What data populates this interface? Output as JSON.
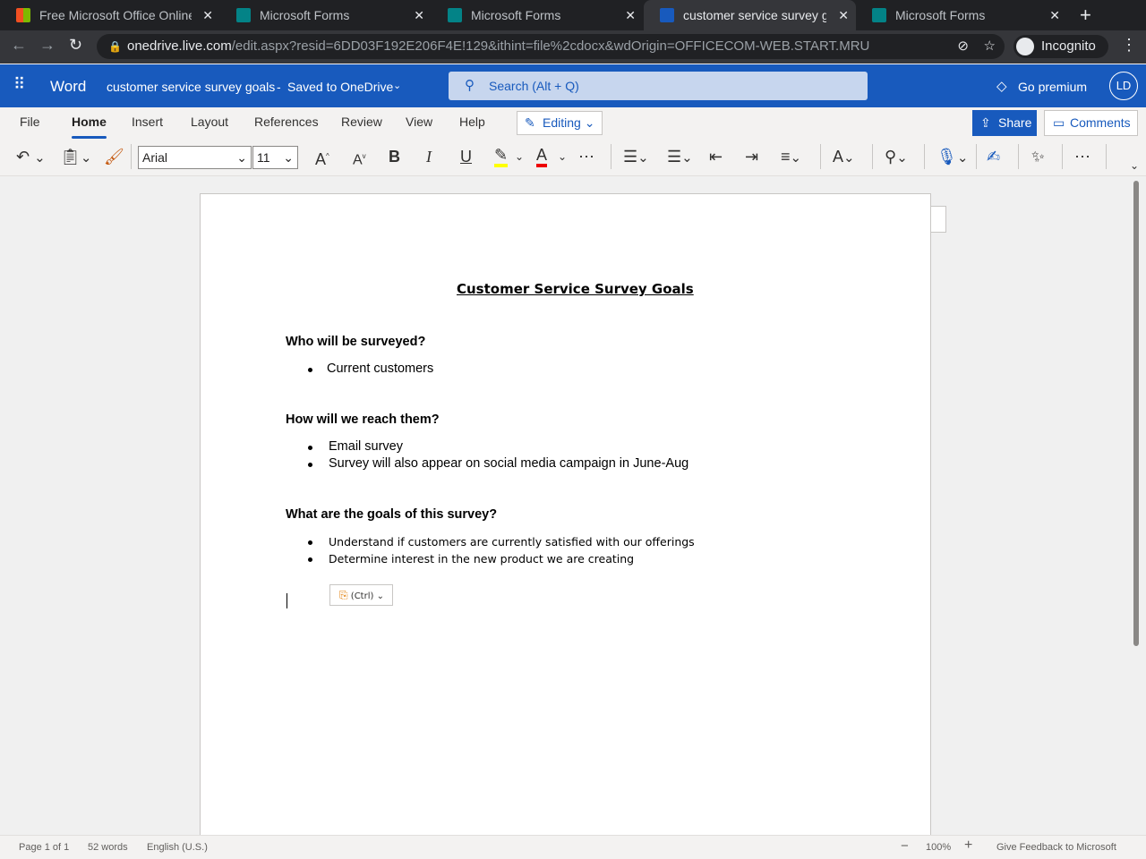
{
  "browser": {
    "tabs": [
      {
        "label": "Free Microsoft Office Online",
        "icon": "microsoft-logo-icon",
        "active": false
      },
      {
        "label": "Microsoft Forms",
        "icon": "forms-icon",
        "active": false
      },
      {
        "label": "Microsoft Forms",
        "icon": "forms-icon",
        "active": false
      },
      {
        "label": "customer service survey goals",
        "icon": "word-icon",
        "active": true
      },
      {
        "label": "Microsoft Forms",
        "icon": "forms-icon",
        "active": false
      }
    ],
    "url_host": "onedrive.live.com",
    "url_path": "/edit.aspx?resid=6DD03F192E206F4E!129&ithint=file%2cdocx&wdOrigin=OFFICECOM-WEB.START.MRU",
    "incognito_label": "Incognito"
  },
  "app": {
    "name": "Word",
    "doc_title": "customer service survey goals",
    "save_status": "Saved to OneDrive",
    "search_placeholder": "Search (Alt + Q)",
    "premium": "Go premium",
    "avatar": "LD",
    "accent": "#185abd"
  },
  "ribbon": {
    "tabs": [
      "File",
      "Home",
      "Insert",
      "Layout",
      "References",
      "Review",
      "View",
      "Help"
    ],
    "active_tab": "Home",
    "editing": "Editing",
    "share": "Share",
    "comments": "Comments",
    "font": "Arial",
    "font_size": "11"
  },
  "document": {
    "title": "Customer Service Survey Goals",
    "sections": [
      {
        "heading": "Who will be surveyed?",
        "bullets": [
          "Current customers"
        ]
      },
      {
        "heading": "How will we reach them?",
        "bullets": [
          "Email survey",
          "Survey will also appear on social media campaign in June-Aug"
        ]
      },
      {
        "heading": "What are the goals of this survey?",
        "bullets": [
          "Understand if customers are currently satisfied with our offerings",
          "Determine interest in the new product we are creating"
        ]
      }
    ],
    "paste_options": "(Ctrl)"
  },
  "status": {
    "page": "Page 1 of 1",
    "words": "52 words",
    "language": "English (U.S.)",
    "zoom": "100%",
    "feedback": "Give Feedback to Microsoft"
  }
}
